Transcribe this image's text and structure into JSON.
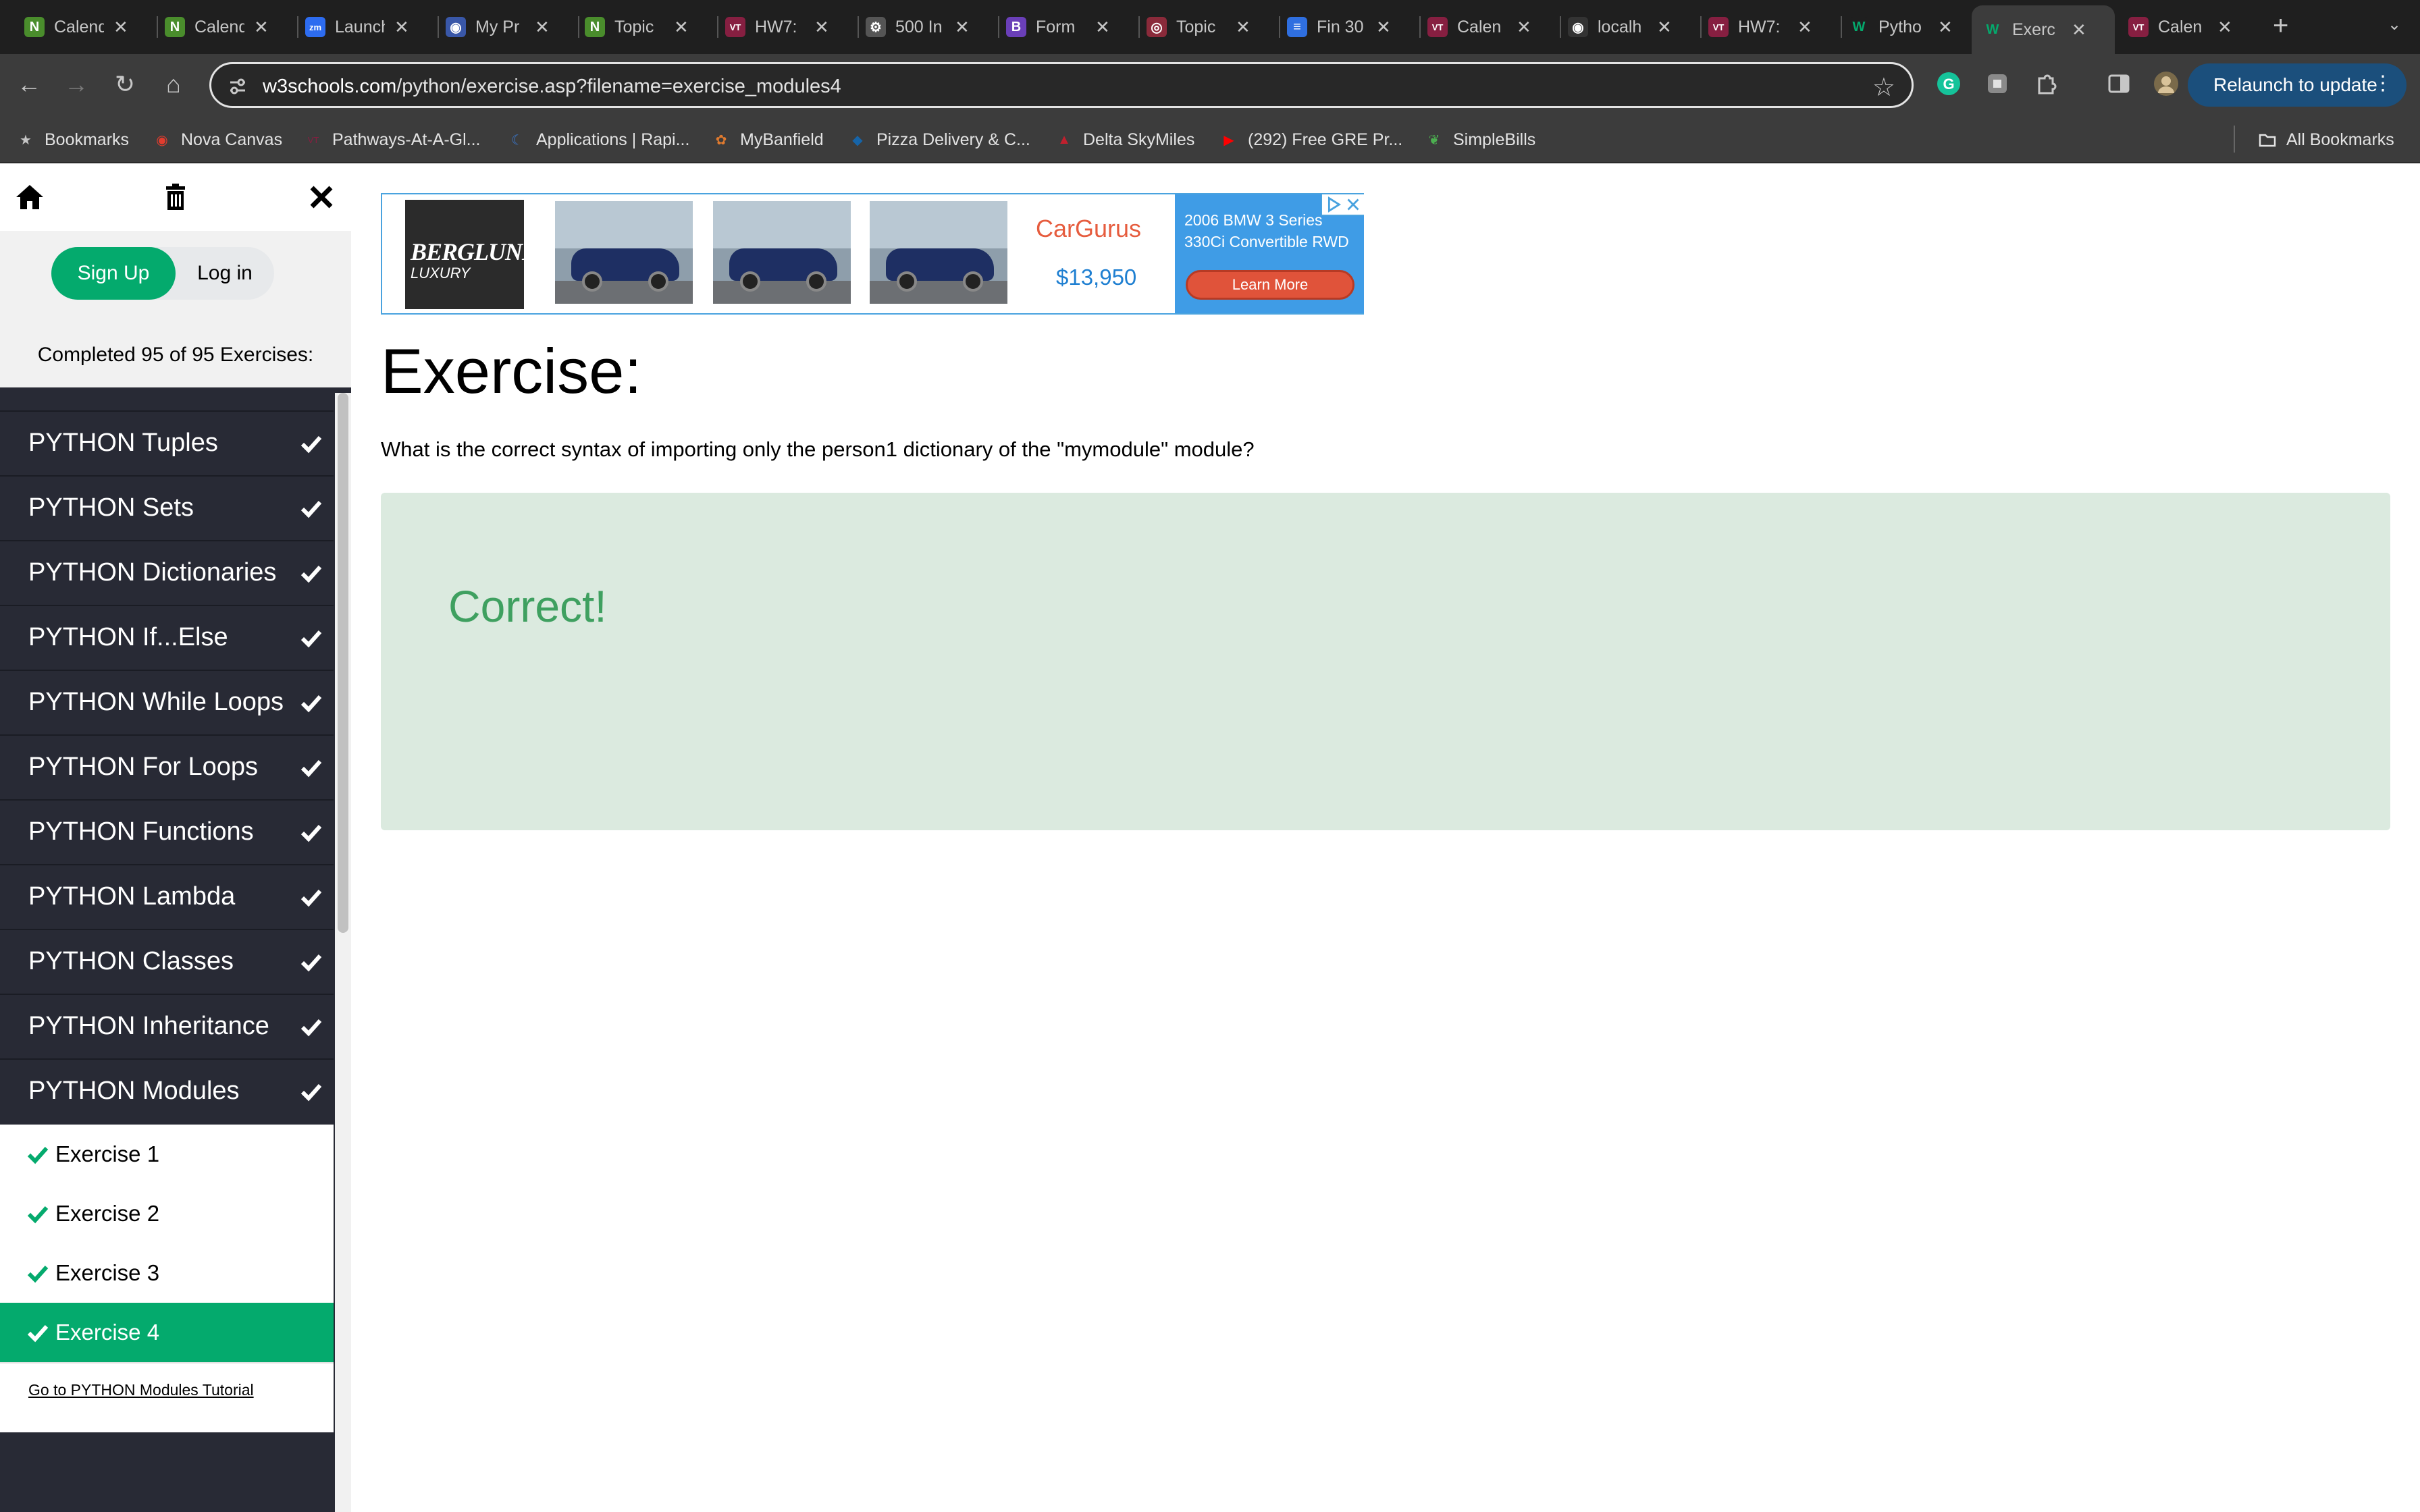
{
  "browser": {
    "tabs": [
      {
        "title": "Calendar",
        "icon": "notion-icon",
        "color": "#ffffff",
        "bg": "#4a8d2c"
      },
      {
        "title": "Calendar",
        "icon": "notion-icon",
        "color": "#ffffff",
        "bg": "#4a8d2c"
      },
      {
        "title": "Launch",
        "icon": "zoom-icon",
        "color": "#ffffff",
        "bg": "#2d6cf0"
      },
      {
        "title": "My Pr",
        "icon": "globe-icon",
        "color": "#ffffff",
        "bg": "#3957a8"
      },
      {
        "title": "Topic",
        "icon": "notion-icon",
        "color": "#ffffff",
        "bg": "#4a8d2c"
      },
      {
        "title": "HW7:",
        "icon": "vt-icon",
        "color": "#ffffff",
        "bg": "#861f41"
      },
      {
        "title": "500 In",
        "icon": "settings-icon",
        "color": "#ffffff",
        "bg": "#555555"
      },
      {
        "title": "Form",
        "icon": "b-icon",
        "color": "#ffffff",
        "bg": "#6a3fb8"
      },
      {
        "title": "Topic",
        "icon": "circle-icon",
        "color": "#ffffff",
        "bg": "#8a2a3a"
      },
      {
        "title": "Fin 30",
        "icon": "docs-icon",
        "color": "#ffffff",
        "bg": "#2f6fe0"
      },
      {
        "title": "Calen",
        "icon": "vt-icon",
        "color": "#ffffff",
        "bg": "#861f41"
      },
      {
        "title": "localh",
        "icon": "globe-icon",
        "color": "#ffffff",
        "bg": "#333333"
      },
      {
        "title": "HW7:",
        "icon": "vt-icon",
        "color": "#ffffff",
        "bg": "#861f41"
      },
      {
        "title": "Pytho",
        "icon": "w3schools-icon",
        "color": "#04aa6d",
        "bg": "#1f1f1f"
      },
      {
        "title": "Exerc",
        "icon": "w3schools-icon",
        "color": "#04aa6d",
        "bg": "#3c3c3c",
        "active": true
      },
      {
        "title": "Calen",
        "icon": "vt-icon",
        "color": "#ffffff",
        "bg": "#861f41"
      }
    ],
    "url_host": "w3schools.com",
    "url_path": "/python/exercise.asp?filename=exercise_modules4",
    "relaunch_label": "Relaunch to update",
    "bookmarks": [
      {
        "label": "Bookmarks",
        "icon": "star-icon"
      },
      {
        "label": "Nova Canvas",
        "icon": "canvas-icon"
      },
      {
        "label": "Pathways-At-A-Gl...",
        "icon": "vt-icon"
      },
      {
        "label": "Applications | Rapi...",
        "icon": "moon-icon"
      },
      {
        "label": "MyBanfield",
        "icon": "banfield-icon"
      },
      {
        "label": "Pizza Delivery & C...",
        "icon": "dominos-icon"
      },
      {
        "label": "Delta SkyMiles",
        "icon": "delta-icon"
      },
      {
        "label": "(292) Free GRE Pr...",
        "icon": "youtube-icon"
      },
      {
        "label": "SimpleBills",
        "icon": "leaf-icon"
      }
    ],
    "all_bookmarks_label": "All Bookmarks"
  },
  "sidebar": {
    "signup_label": "Sign Up",
    "login_label": "Log in",
    "completed_text": "Completed 95 of 95 Exercises:",
    "categories": [
      "PYTHON Tuples",
      "PYTHON Sets",
      "PYTHON Dictionaries",
      "PYTHON If...Else",
      "PYTHON While Loops",
      "PYTHON For Loops",
      "PYTHON Functions",
      "PYTHON Lambda",
      "PYTHON Classes",
      "PYTHON Inheritance",
      "PYTHON Modules"
    ],
    "exercises": [
      "Exercise 1",
      "Exercise 2",
      "Exercise 3",
      "Exercise 4"
    ],
    "current_exercise": "Exercise 4",
    "goto_link": "Go to PYTHON Modules Tutorial",
    "accent": "#04aa6d"
  },
  "ad": {
    "logo_line1": "BERGLUND",
    "logo_line2": "LUXURY",
    "brand": "CarGurus",
    "price": "$13,950",
    "description": "2006 BMW 3 Series 330Ci Convertible RWD",
    "cta": "Learn More"
  },
  "main": {
    "heading": "Exercise:",
    "question": "What is the correct syntax of importing only the person1 dictionary of the \"mymodule\" module?",
    "result": "Correct!"
  }
}
